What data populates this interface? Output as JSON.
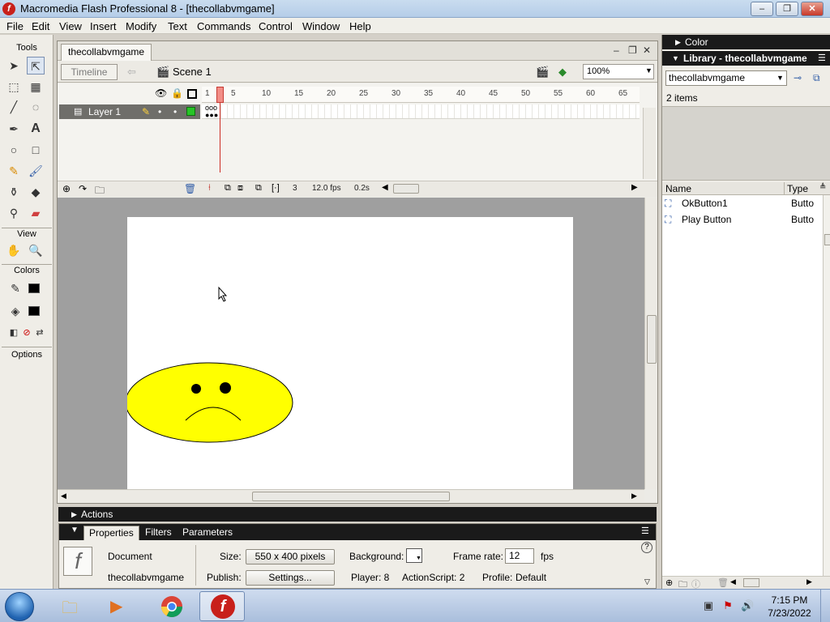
{
  "window": {
    "title": "Macromedia Flash Professional 8 - [thecollabvmgame]",
    "minimize": "–",
    "restore": "❐",
    "close": "✕"
  },
  "menu": [
    "File",
    "Edit",
    "View",
    "Insert",
    "Modify",
    "Text",
    "Commands",
    "Control",
    "Window",
    "Help"
  ],
  "tools": {
    "title": "Tools",
    "view_title": "View",
    "colors_title": "Colors",
    "options_title": "Options"
  },
  "document": {
    "tab": "thecollabvmgame",
    "timeline_button": "Timeline",
    "scene": "Scene 1",
    "zoom": "100%",
    "doc_min": "–",
    "doc_restore": "❐",
    "doc_close": "✕"
  },
  "timeline": {
    "layer_name": "Layer 1",
    "ruler": [
      "1",
      "5",
      "10",
      "15",
      "20",
      "25",
      "30",
      "35",
      "40",
      "45",
      "50",
      "55",
      "60",
      "65"
    ],
    "current_frame": "3",
    "fps": "12.0 fps",
    "elapsed": "0.2s"
  },
  "actions": {
    "label": "Actions"
  },
  "properties": {
    "tabs": [
      "Properties",
      "Filters",
      "Parameters"
    ],
    "doc_type": "Document",
    "doc_name": "thecollabvmgame",
    "size_label": "Size:",
    "size_value": "550 x 400 pixels",
    "publish_label": "Publish:",
    "settings_button": "Settings...",
    "background_label": "Background:",
    "player_label": "Player: 8",
    "actionscript_label": "ActionScript:  2",
    "framerate_label": "Frame rate:",
    "framerate_value": "12",
    "fps_unit": "fps",
    "profile_label": "Profile:",
    "profile_value": "Default",
    "help": "?"
  },
  "color_panel": {
    "title": "Color"
  },
  "library": {
    "title": "Library - thecollabvmgame",
    "selected": "thecollabvmgame",
    "count": "2 items",
    "col_name": "Name",
    "col_type": "Type",
    "items": [
      {
        "name": "OkButton1",
        "type": "Butto"
      },
      {
        "name": "Play Button",
        "type": "Butto"
      }
    ]
  },
  "taskbar": {
    "time": "7:15 PM",
    "date": "7/23/2022"
  },
  "colors": {
    "stage_bg": "#ffffff",
    "face_fill": "#ffff00",
    "playhead": "#cc2b22"
  }
}
